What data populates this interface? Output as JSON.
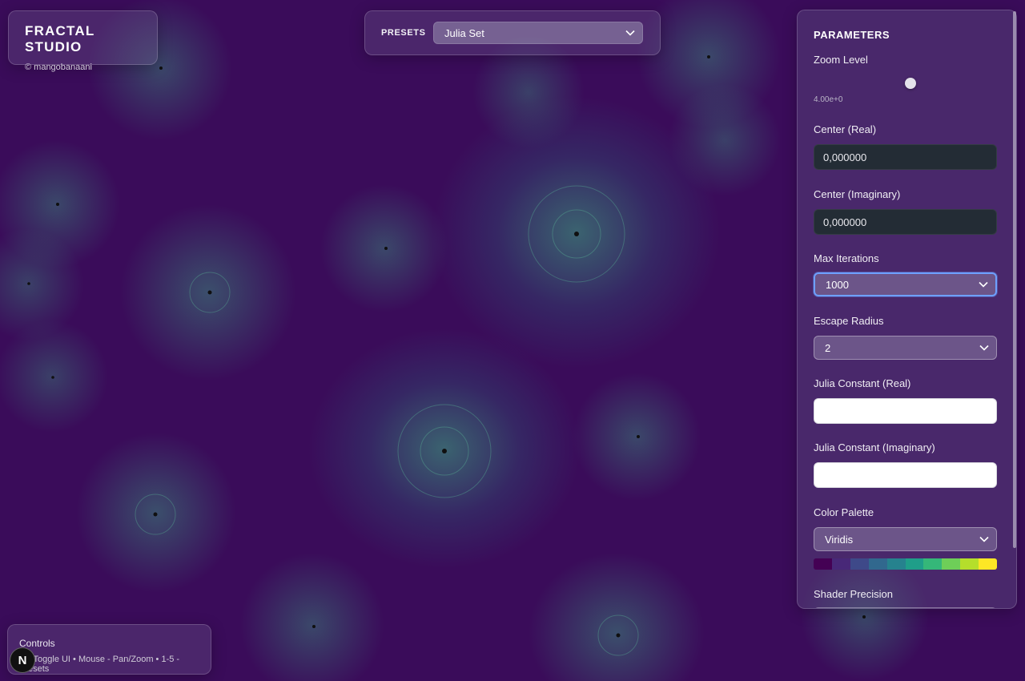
{
  "header": {
    "title": "FRACTAL STUDIO",
    "credit": "© mangobanaani"
  },
  "presets": {
    "label": "PRESETS",
    "selected": "Julia Set"
  },
  "parameters": {
    "title": "PARAMETERS",
    "zoom": {
      "label": "Zoom Level",
      "readout": "4.00e+0",
      "slider_fraction": 0.53
    },
    "center_real": {
      "label": "Center (Real)",
      "value": "0,000000"
    },
    "center_imag": {
      "label": "Center (Imaginary)",
      "value": "0,000000"
    },
    "max_iterations": {
      "label": "Max Iterations",
      "selected": "1000"
    },
    "escape_radius": {
      "label": "Escape Radius",
      "selected": "2"
    },
    "julia_real": {
      "label": "Julia Constant (Real)",
      "value": ""
    },
    "julia_imag": {
      "label": "Julia Constant (Imaginary)",
      "value": ""
    },
    "color_palette": {
      "label": "Color Palette",
      "selected": "Viridis",
      "swatches": [
        "#440154",
        "#482878",
        "#3e4989",
        "#31688e",
        "#26828e",
        "#1f9e89",
        "#35b779",
        "#6ece58",
        "#b5de2b",
        "#fde725"
      ]
    },
    "shader_precision": {
      "label": "Shader Precision"
    }
  },
  "controls": {
    "title": "Controls",
    "text": "H - Toggle UI • Mouse - Pan/Zoom • 1-5 - Presets"
  },
  "badge": {
    "letter": "N"
  },
  "colors": {
    "background": "#3a0c5a",
    "fractal_glow": "#3caa82",
    "focus_ring": "#6ea0ff",
    "input_dark": "#232c35"
  },
  "icons": {
    "select_chevron": "chevron-down-icon"
  }
}
